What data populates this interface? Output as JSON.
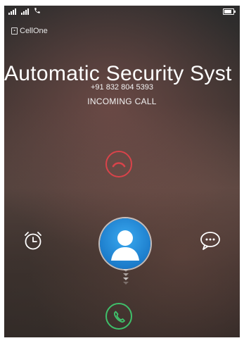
{
  "statusbar": {
    "icons": [
      "signal-icon",
      "signal-icon",
      "phone-icon",
      "battery-icon"
    ],
    "battery_level": 1.0
  },
  "carrier": {
    "name": "CellOne",
    "icon": "sim-icon"
  },
  "caller": {
    "name": "Automatic Security Syst",
    "number": "+91 832 804 5393",
    "status": "INCOMING CALL"
  },
  "actions": {
    "decline_icon": "decline-call-icon",
    "accept_icon": "accept-call-icon",
    "reminder_icon": "alarm-clock-icon",
    "message_icon": "message-bubble-icon",
    "decline_color": "#d9434a",
    "accept_color": "#3fbf6a",
    "avatar_color": "#2590e0"
  }
}
